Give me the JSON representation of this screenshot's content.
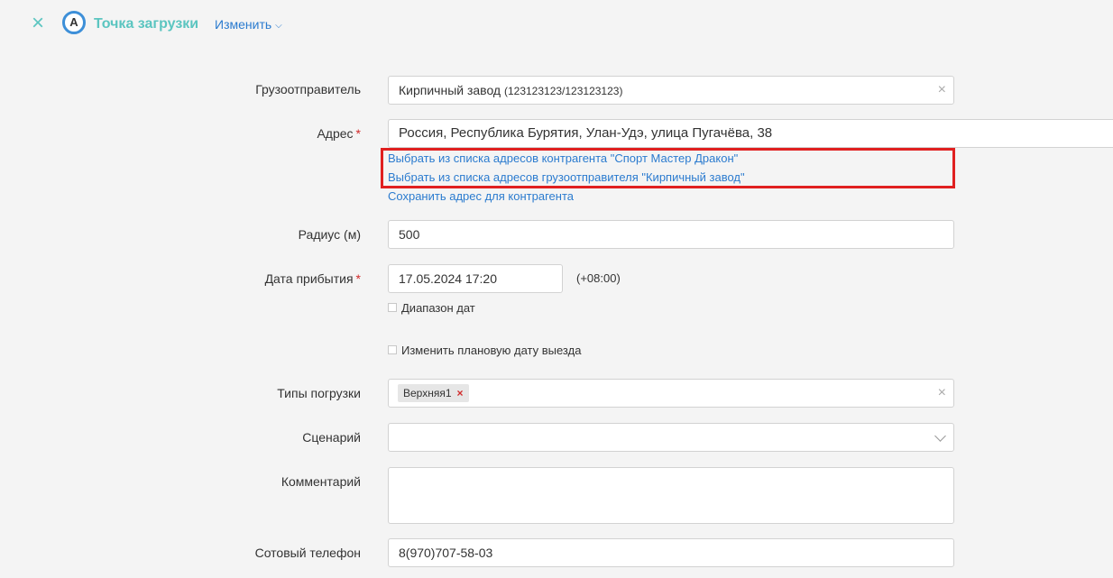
{
  "header": {
    "close_icon": "×",
    "point_badge": "А",
    "title": "Точка загрузки",
    "edit_menu_label": "Изменить",
    "edit_menu_chevron": "⌄"
  },
  "form": {
    "shipper": {
      "label": "Грузоотправитель",
      "value_name": "Кирпичный завод",
      "value_code": "(123123123/123123123)"
    },
    "address": {
      "label": "Адрес",
      "required_mark": "*",
      "value": "Россия, Республика Бурятия, Улан-Удэ, улица Пугачёва, 38",
      "link_contractor": "Выбрать из списка адресов контрагента \"Спорт Мастер Дракон\"",
      "link_shipper": "Выбрать из списка адресов грузоотправителя \"Кирпичный завод\"",
      "link_save": "Сохранить адрес для контрагента"
    },
    "radius": {
      "label": "Радиус (м)",
      "value": "500"
    },
    "arrival_date": {
      "label": "Дата прибытия",
      "required_mark": "*",
      "value": "17.05.2024 17:20",
      "timezone": "(+08:00)",
      "date_range_label": "Диапазон дат"
    },
    "change_departure_label": "Изменить плановую дату выезда",
    "loading_types": {
      "label": "Типы погрузки",
      "tags": [
        "Верхняя1"
      ]
    },
    "scenario": {
      "label": "Сценарий",
      "value": ""
    },
    "comment": {
      "label": "Комментарий",
      "value": ""
    },
    "mobile_phone": {
      "label": "Сотовый телефон",
      "value": "8(970)707-58-03"
    }
  }
}
